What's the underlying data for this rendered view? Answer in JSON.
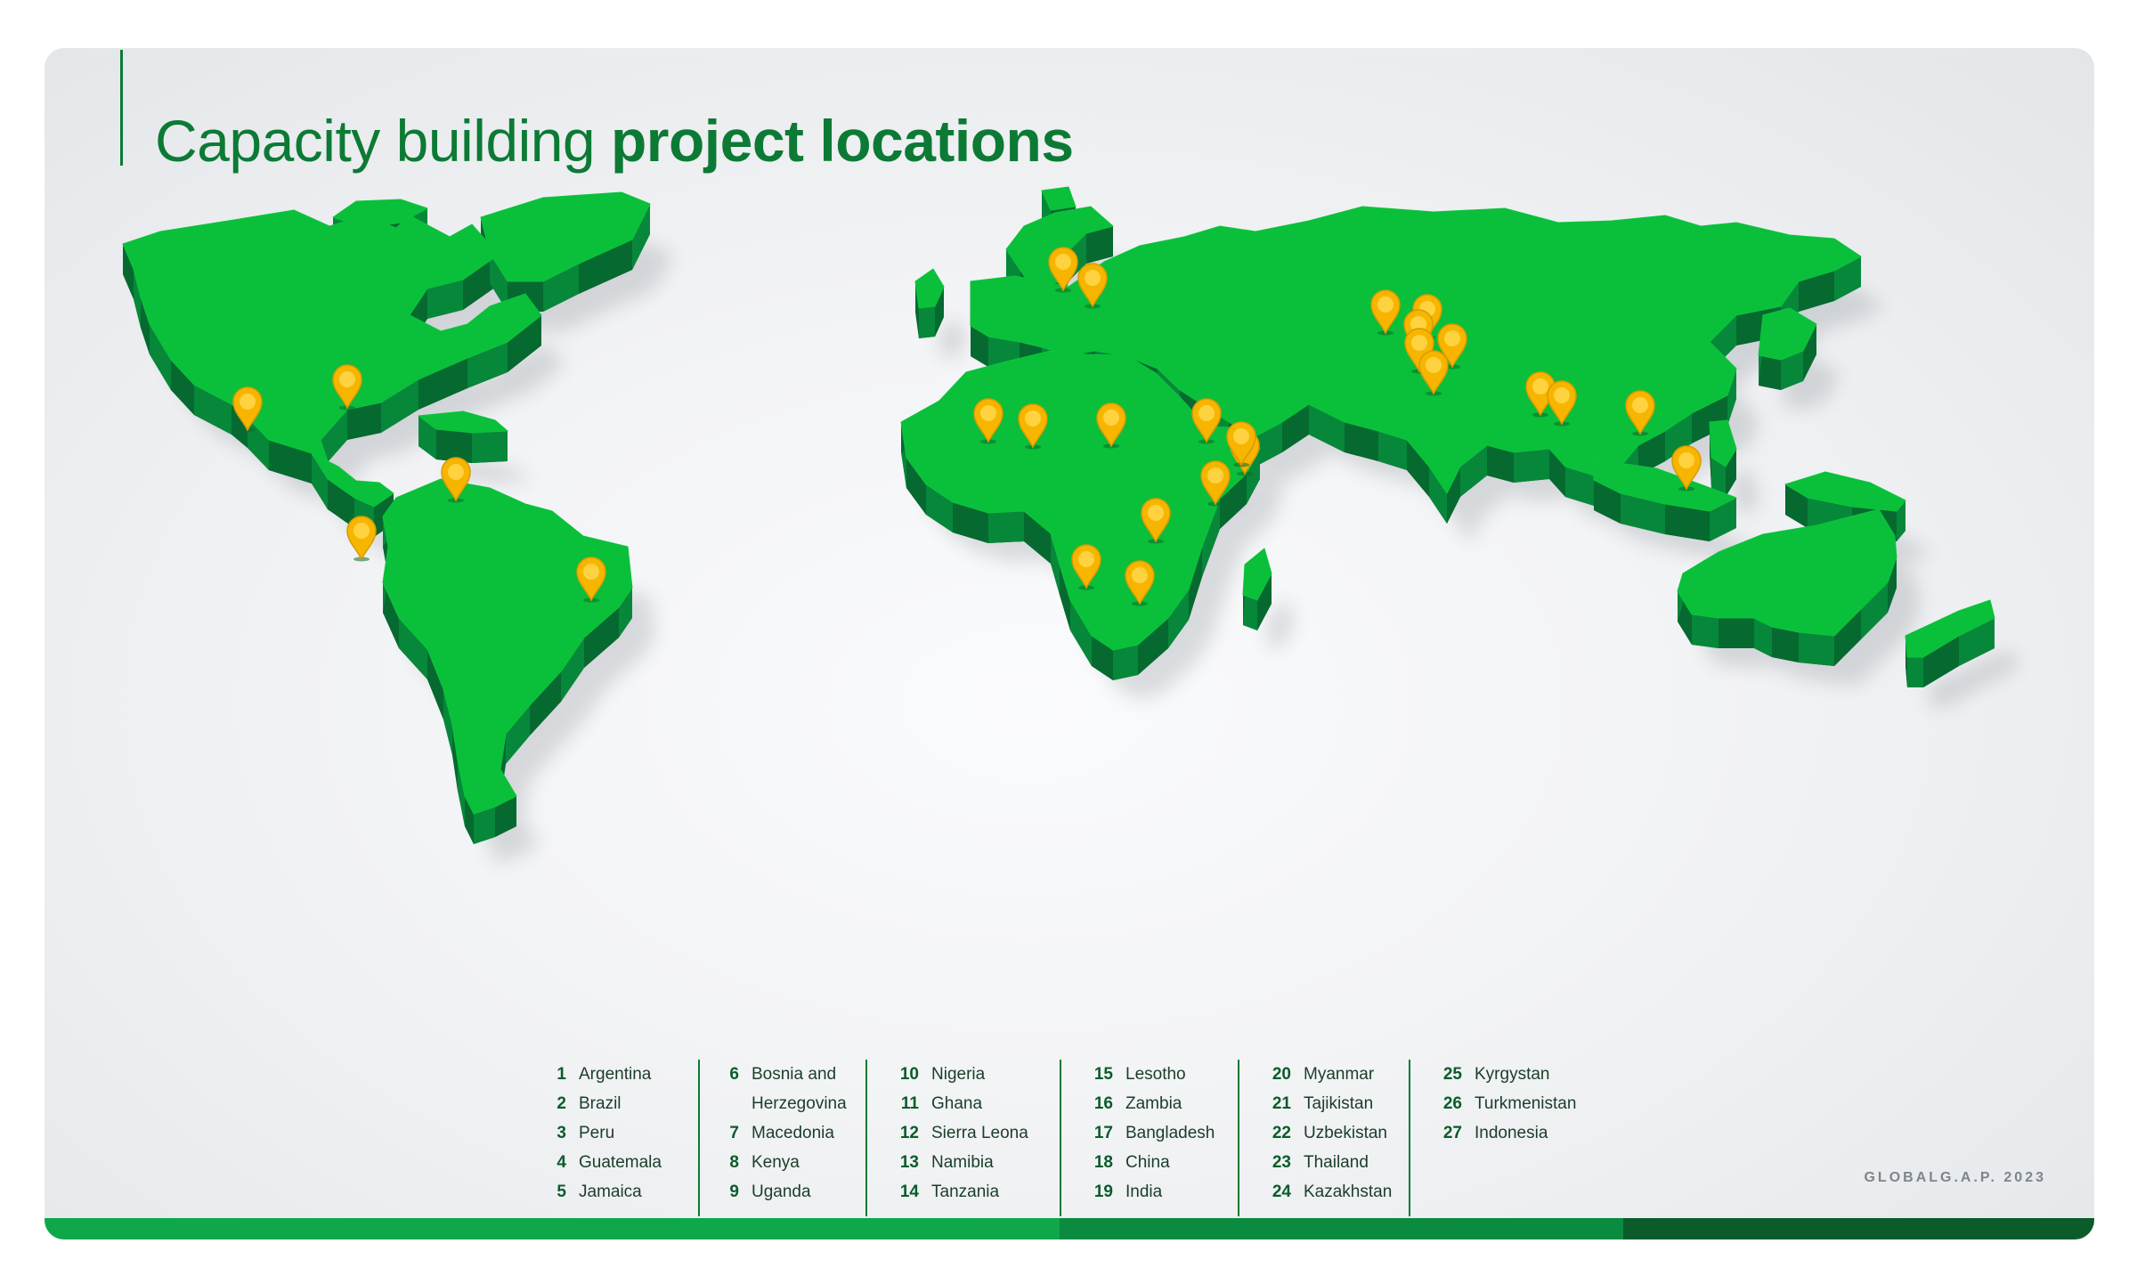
{
  "title": {
    "regular": "Capacity building",
    "bold": "project locations"
  },
  "legend": {
    "columns": [
      [
        {
          "n": "1",
          "name": "Argentina"
        },
        {
          "n": "2",
          "name": "Brazil"
        },
        {
          "n": "3",
          "name": "Peru"
        },
        {
          "n": "4",
          "name": "Guatemala"
        },
        {
          "n": "5",
          "name": "Jamaica"
        }
      ],
      [
        {
          "n": "6",
          "name": "Bosnia and"
        },
        {
          "n": "",
          "name": "Herzegovina"
        },
        {
          "n": "7",
          "name": "Macedonia"
        },
        {
          "n": "8",
          "name": "Kenya"
        },
        {
          "n": "9",
          "name": "Uganda"
        }
      ],
      [
        {
          "n": "10",
          "name": "Nigeria"
        },
        {
          "n": "11",
          "name": "Ghana"
        },
        {
          "n": "12",
          "name": "Sierra Leona"
        },
        {
          "n": "13",
          "name": "Namibia"
        },
        {
          "n": "14",
          "name": "Tanzania"
        }
      ],
      [
        {
          "n": "15",
          "name": "Lesotho"
        },
        {
          "n": "16",
          "name": "Zambia"
        },
        {
          "n": "17",
          "name": "Bangladesh"
        },
        {
          "n": "18",
          "name": "China"
        },
        {
          "n": "19",
          "name": "India"
        }
      ],
      [
        {
          "n": "20",
          "name": "Myanmar"
        },
        {
          "n": "21",
          "name": "Tajikistan"
        },
        {
          "n": "22",
          "name": "Uzbekistan"
        },
        {
          "n": "23",
          "name": "Thailand"
        },
        {
          "n": "24",
          "name": "Kazakhstan"
        }
      ],
      [
        {
          "n": "25",
          "name": "Kyrgystan"
        },
        {
          "n": "26",
          "name": "Turkmenistan"
        },
        {
          "n": "27",
          "name": "Indonesia"
        }
      ]
    ]
  },
  "brand": "GLOBALG.A.P. 2023",
  "colors": {
    "land_top": "#0abf3a",
    "land_side": "#07873a",
    "land_side_dark": "#066930",
    "pin": "#f7b500",
    "pin_inner": "#ffd23f",
    "title": "#0c7a35",
    "bar_segments": [
      "#0ea84a",
      "#0b8b3f",
      "#0a5c2b"
    ]
  },
  "icons": {
    "marker": "location-pin-icon"
  }
}
